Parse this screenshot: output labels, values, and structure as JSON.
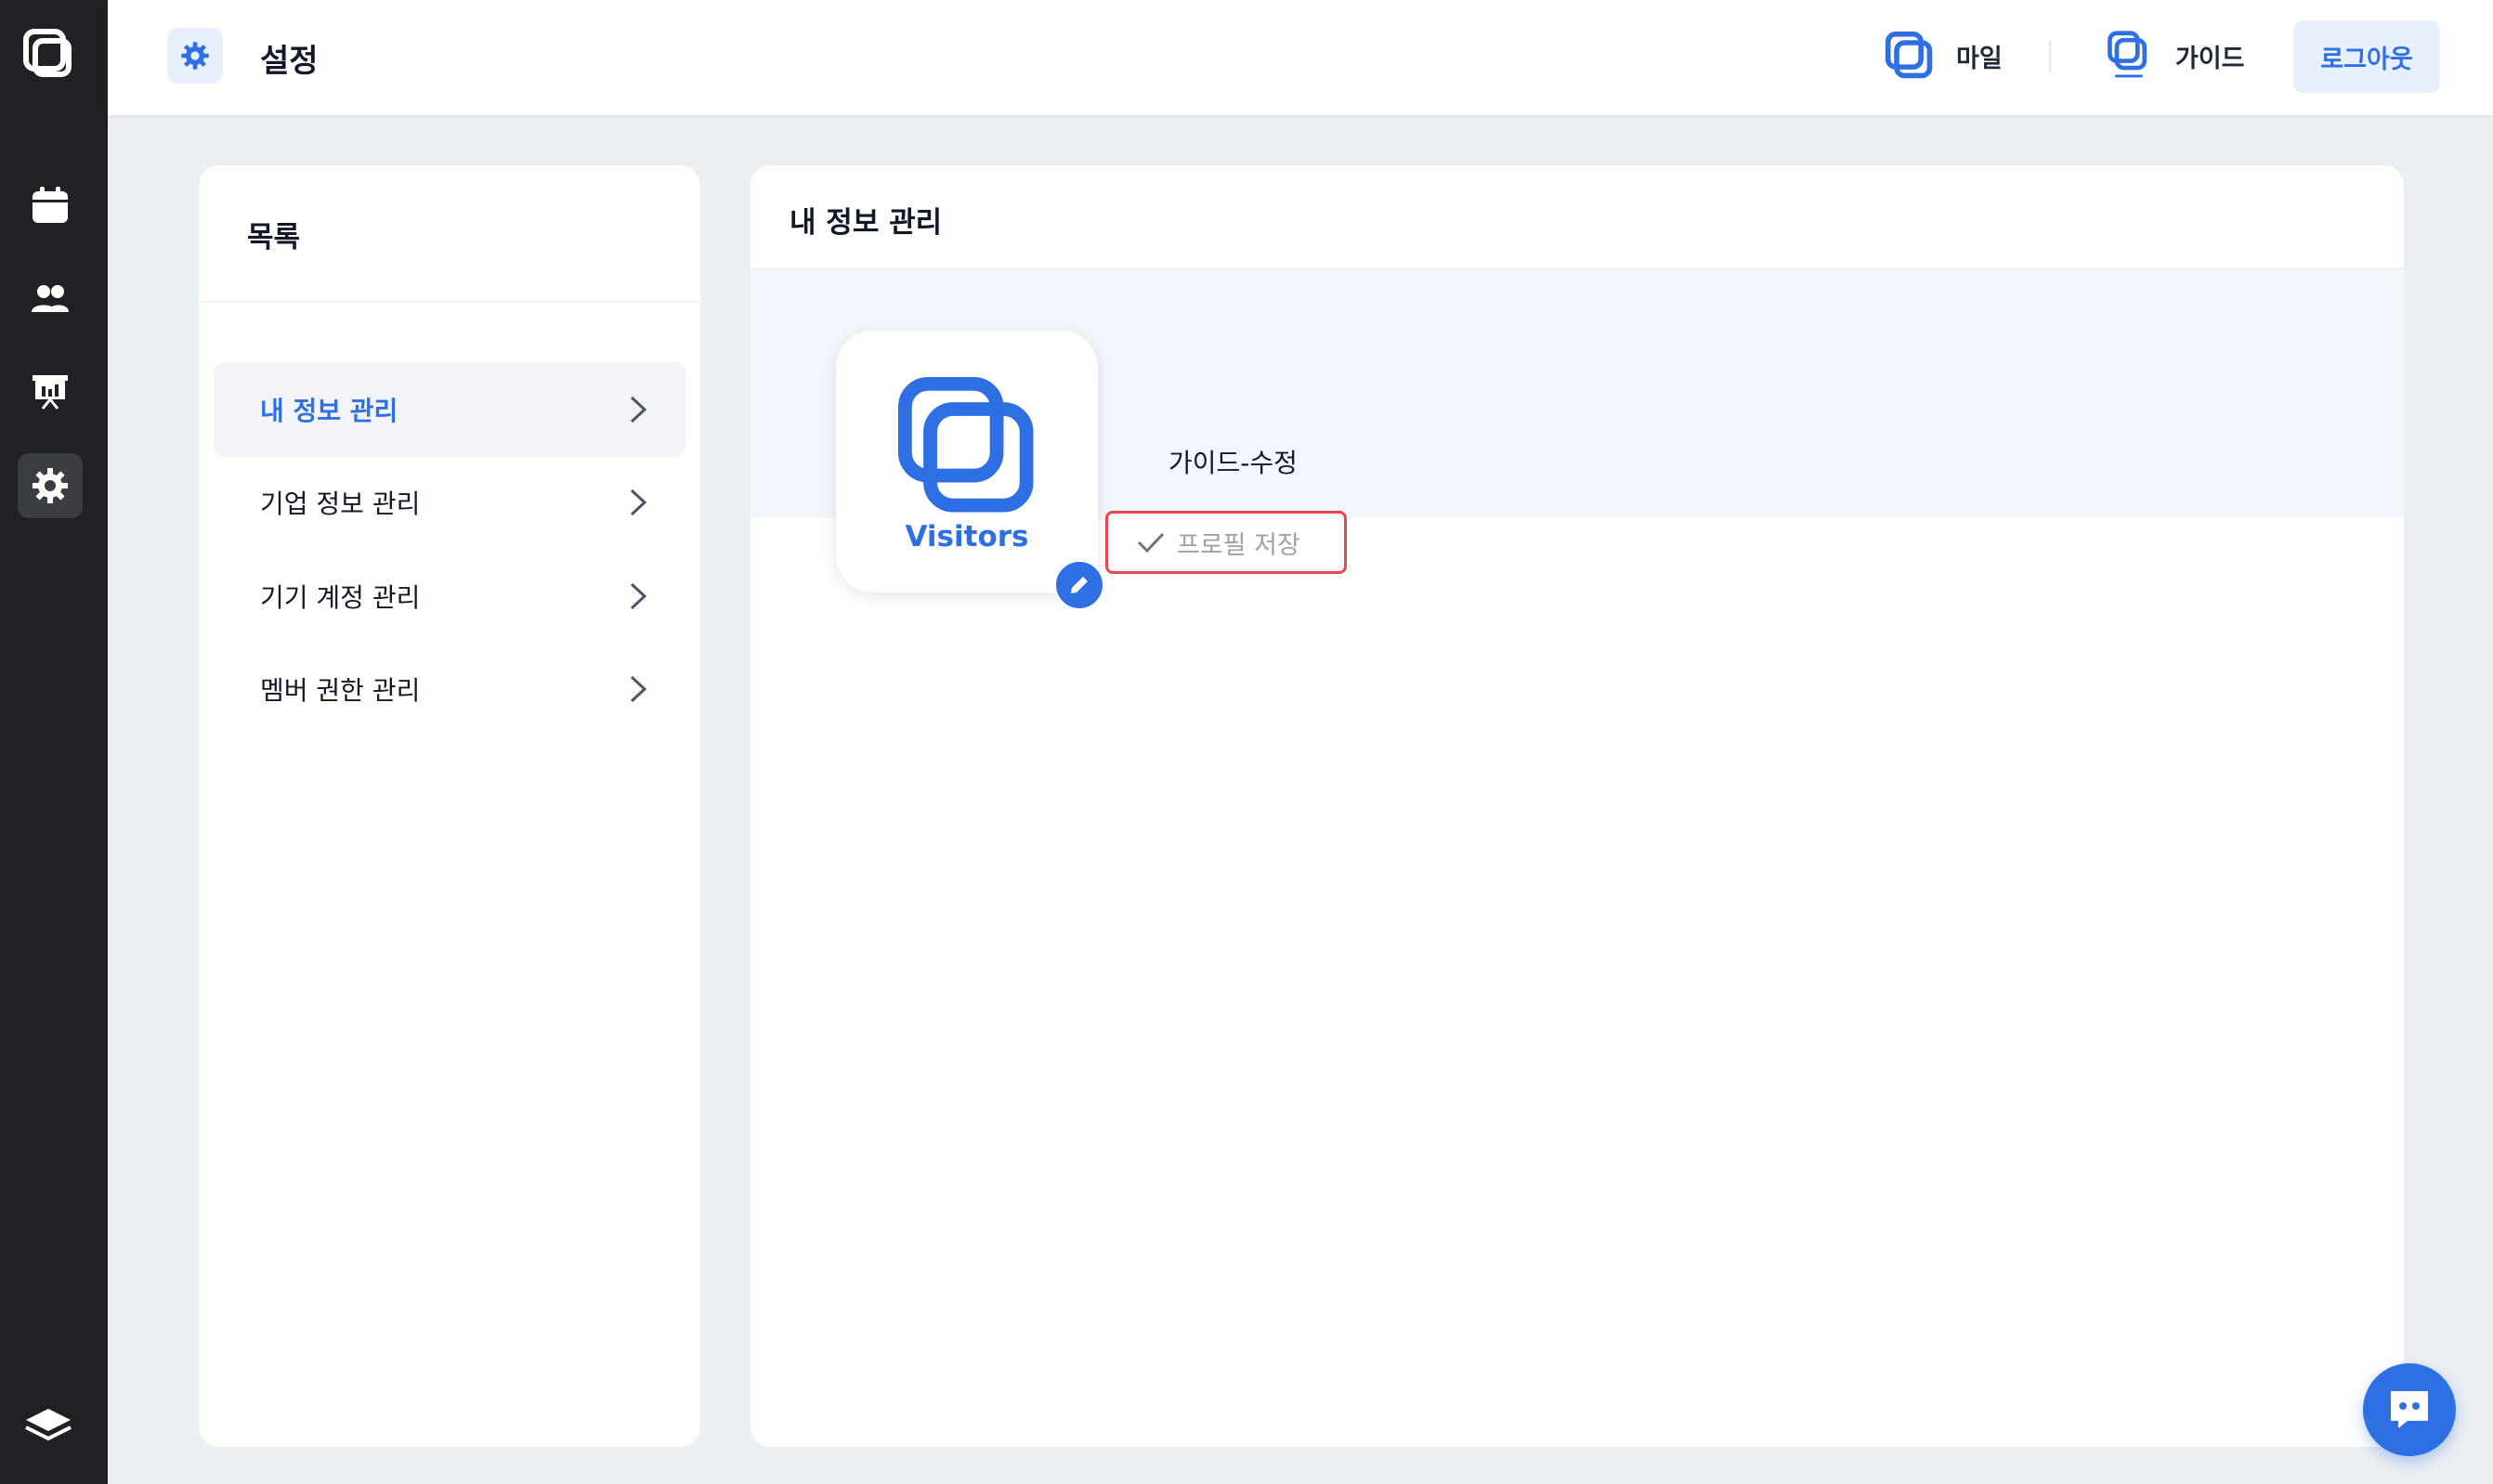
{
  "header": {
    "title": "설정",
    "links": [
      {
        "label": "마일",
        "icon": "visitors-logo-icon"
      },
      {
        "label": "가이드",
        "icon": "visitors-guide-logo-icon"
      }
    ],
    "logout_label": "로그아웃"
  },
  "sidebar_rail": {
    "items": [
      "logo-icon",
      "calendar-icon",
      "people-icon",
      "presentation-icon",
      "gear-icon"
    ],
    "active": "gear-icon",
    "bottom": "layers-icon"
  },
  "menu": {
    "title": "목록",
    "items": [
      {
        "label": "내 정보 관리",
        "active": true
      },
      {
        "label": "기업 정보 관리",
        "active": false
      },
      {
        "label": "기기 계정 관리",
        "active": false
      },
      {
        "label": "멤버 권한 관리",
        "active": false
      }
    ]
  },
  "main": {
    "title": "내 정보 관리",
    "avatar_brand": "Visitors",
    "name_value": "가이드-수정",
    "save_label": "프로필 저장"
  },
  "colors": {
    "accent": "#2f6fe4",
    "rail": "#202124",
    "highlight_border": "#e5484d"
  }
}
